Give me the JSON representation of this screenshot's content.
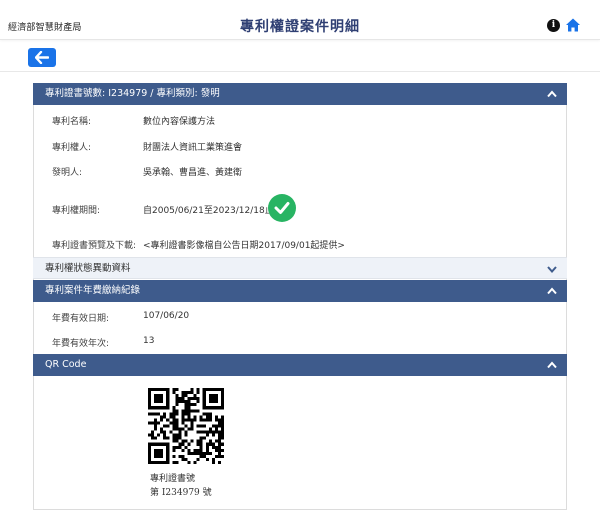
{
  "header": {
    "agency": "經濟部智慧財產局",
    "title": "專利權證案件明細"
  },
  "icons": {
    "info": "info-icon",
    "home": "home-icon",
    "back": "arrow-left-icon",
    "valid": "check-circle-icon",
    "expand": "chevron-up-icon",
    "collapse": "chevron-down-icon"
  },
  "colors": {
    "header_bar": "#3e5b8c",
    "back_button": "#1a73e8",
    "valid_check": "#28b463",
    "title": "#2f3f73"
  },
  "patent": {
    "header": "專利證書號數: I234979 / 專利類別: 發明",
    "rows": [
      {
        "label": "專利名稱:",
        "value": "數位內容保護方法"
      },
      {
        "label": "專利權人:",
        "value": "財團法人資訊工業策進會"
      },
      {
        "label": "發明人:",
        "value": "吳承翰、曹昌進、黃建衛"
      },
      {
        "label": "專利權期間:",
        "value": "自2005/06/21至2023/12/18止"
      },
      {
        "label": "專利證書預覽及下載:",
        "value": "<專利證書影像檔自公告日期2017/09/01起提供>"
      }
    ]
  },
  "status_section": {
    "header": "專利權狀態異動資料"
  },
  "fee_section": {
    "header": "專利案件年費繳納紀錄",
    "rows": [
      {
        "label": "年費有效日期:",
        "value": "107/06/20"
      },
      {
        "label": "年費有效年次:",
        "value": "13"
      }
    ]
  },
  "qr_section": {
    "header": "QR Code",
    "caption_line1": "專利證書號",
    "caption_line2": "第 I234979 號"
  }
}
